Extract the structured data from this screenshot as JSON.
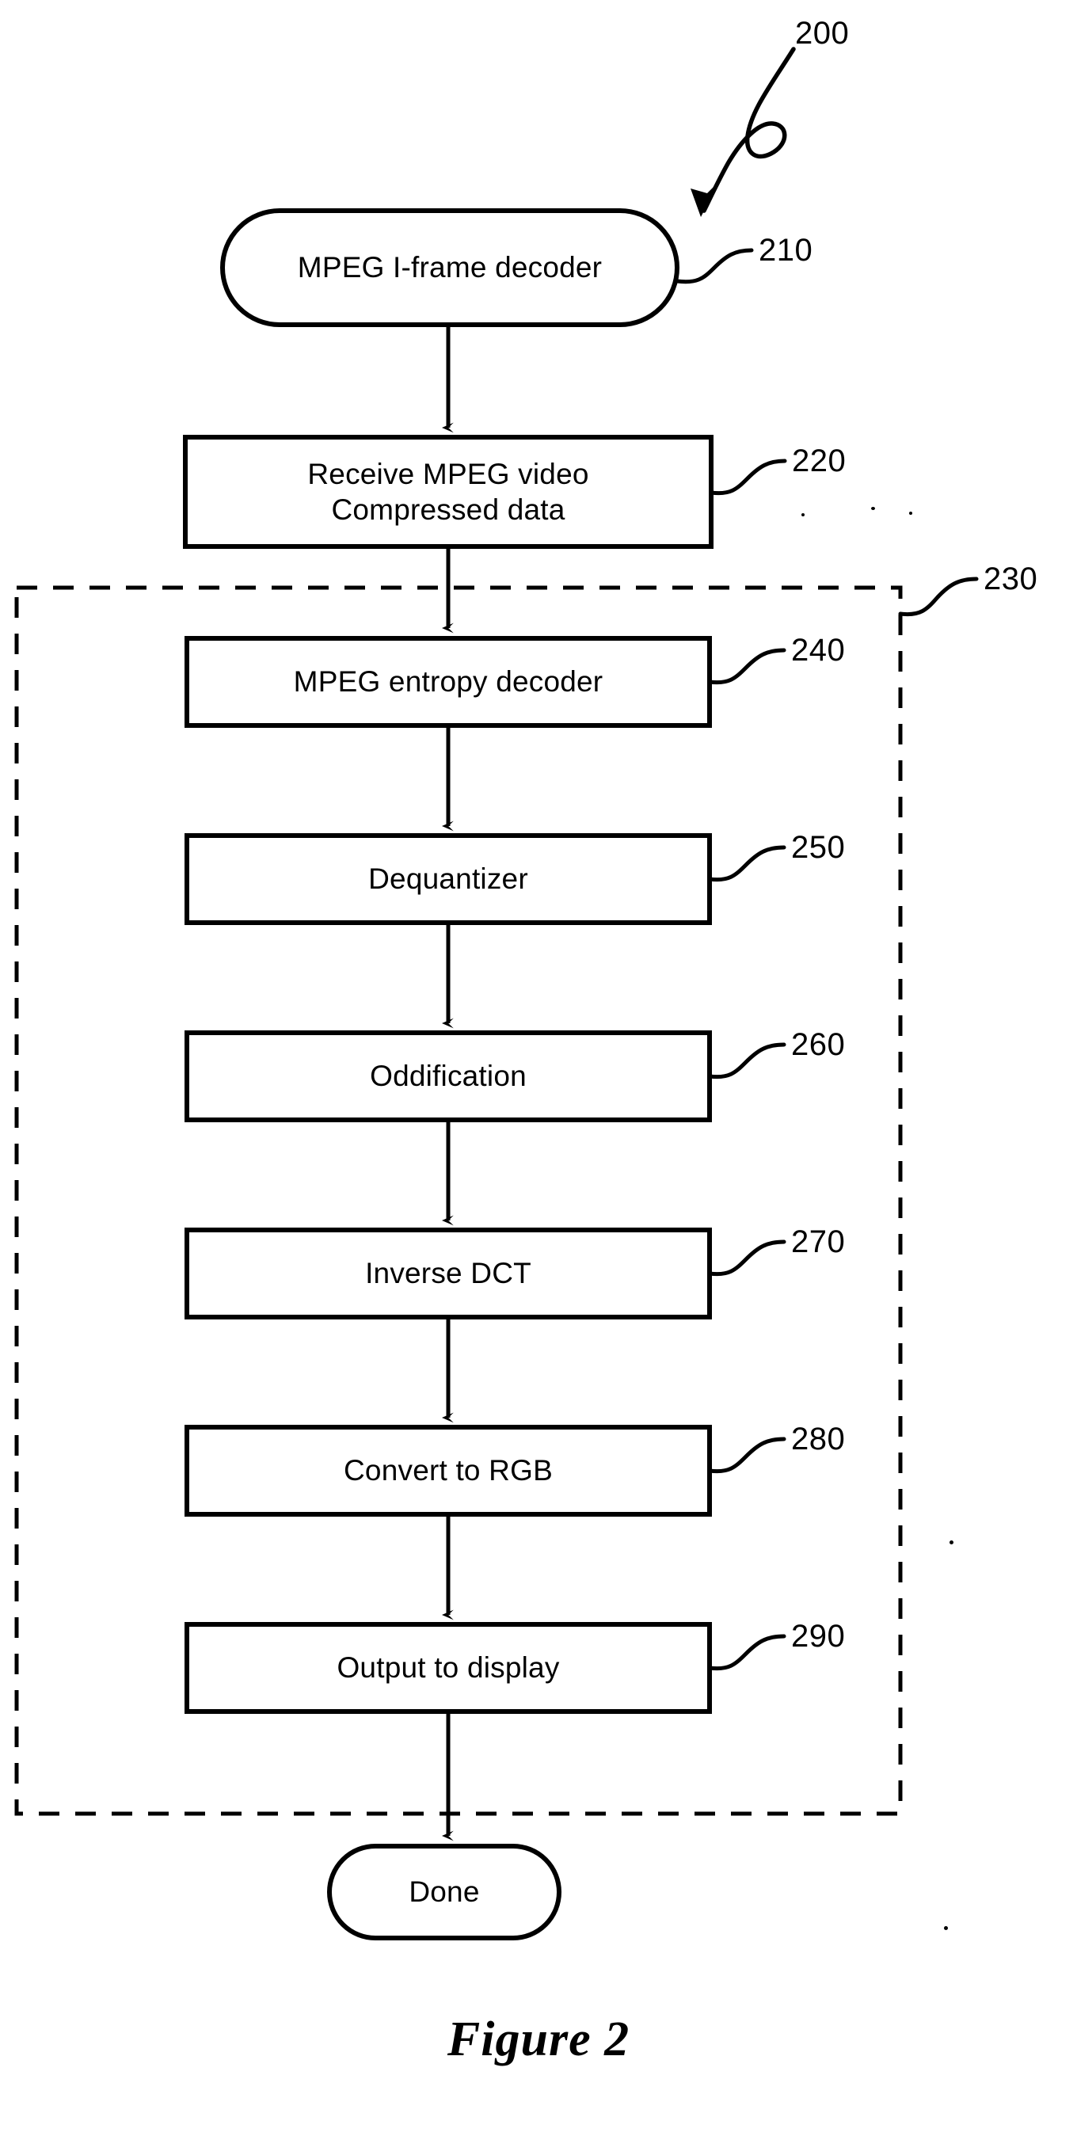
{
  "figure": {
    "caption": "Figure 2",
    "diagram_reference": "200"
  },
  "diagram": {
    "type": "flowchart",
    "title_reference": "200",
    "group_boundary": {
      "name": "decode-loop-dashed-boundary",
      "reference": "230",
      "style": "dashed"
    },
    "nodes": [
      {
        "id": "210",
        "shape": "terminator",
        "label": "MPEG I-frame decoder",
        "reference": "210"
      },
      {
        "id": "220",
        "shape": "process",
        "label": "Receive MPEG video\nCompressed data",
        "reference": "220"
      },
      {
        "id": "240",
        "shape": "process",
        "label": "MPEG entropy decoder",
        "reference": "240"
      },
      {
        "id": "250",
        "shape": "process",
        "label": "Dequantizer",
        "reference": "250"
      },
      {
        "id": "260",
        "shape": "process",
        "label": "Oddification",
        "reference": "260"
      },
      {
        "id": "270",
        "shape": "process",
        "label": "Inverse DCT",
        "reference": "270"
      },
      {
        "id": "280",
        "shape": "process",
        "label": "Convert to RGB",
        "reference": "280"
      },
      {
        "id": "290",
        "shape": "process",
        "label": "Output to display",
        "reference": "290"
      },
      {
        "id": "done",
        "shape": "terminator",
        "label": "Done",
        "reference": ""
      }
    ],
    "edges": [
      {
        "from": "210",
        "to": "220"
      },
      {
        "from": "220",
        "to": "240"
      },
      {
        "from": "240",
        "to": "250"
      },
      {
        "from": "250",
        "to": "260"
      },
      {
        "from": "260",
        "to": "270"
      },
      {
        "from": "270",
        "to": "280"
      },
      {
        "from": "280",
        "to": "290"
      },
      {
        "from": "290",
        "to": "done"
      }
    ],
    "colors": {
      "ink": "#000000",
      "paper": "#ffffff"
    }
  }
}
